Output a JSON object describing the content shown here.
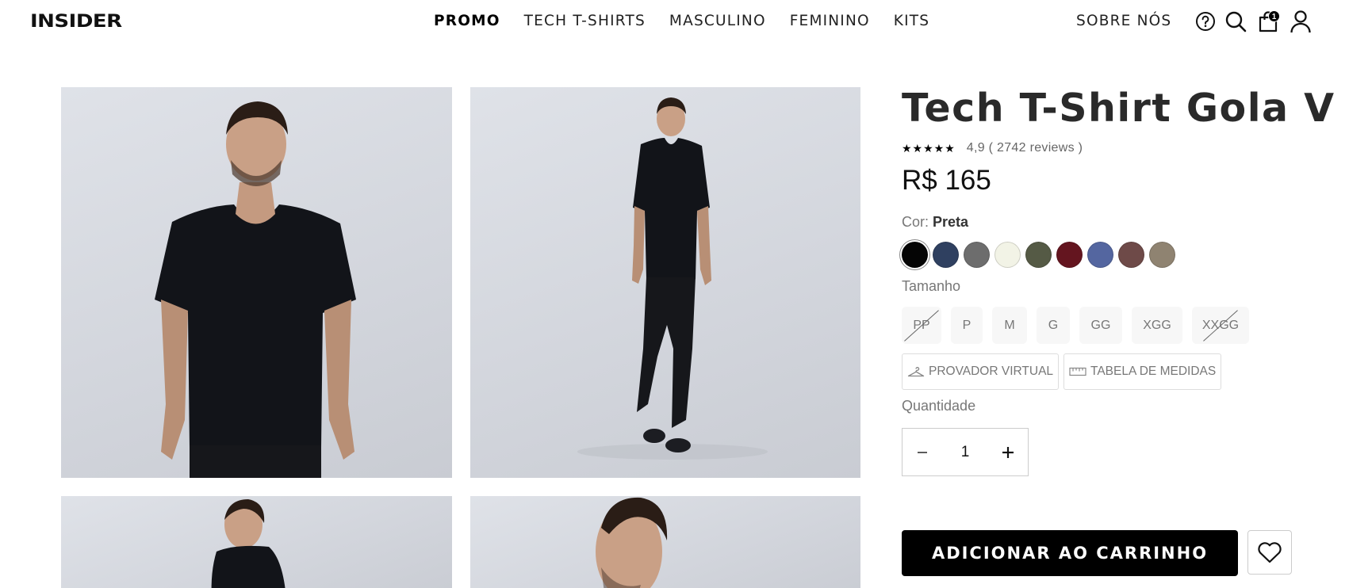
{
  "header": {
    "logo": "INSIDER",
    "nav": [
      "PROMO",
      "TECH T-SHIRTS",
      "MASCULINO",
      "FEMININO",
      "KITS"
    ],
    "about": "SOBRE NÓS",
    "cart_count": "1",
    "icons": [
      "help-icon",
      "search-icon",
      "cart-icon",
      "user-icon"
    ]
  },
  "product": {
    "title": "Tech T-Shirt Gola V",
    "stars": "★★★★★",
    "rating_text": "4,9 ( 2742 reviews )",
    "price": "R$ 165",
    "color_label": "Cor:",
    "color_selected": "Preta",
    "colors": [
      "#050505",
      "#2f4060",
      "#6d6d6d",
      "#f2f3e6",
      "#555a45",
      "#64151f",
      "#5466a0",
      "#6e4a48",
      "#8f8371"
    ],
    "size_label": "Tamanho",
    "sizes": [
      {
        "label": "PP",
        "available": false
      },
      {
        "label": "P",
        "available": true
      },
      {
        "label": "M",
        "available": true
      },
      {
        "label": "G",
        "available": true
      },
      {
        "label": "GG",
        "available": true
      },
      {
        "label": "XGG",
        "available": true
      },
      {
        "label": "XXGG",
        "available": false
      }
    ],
    "virtual_fitting": "PROVADOR VIRTUAL",
    "size_chart": "TABELA DE MEDIDAS",
    "quantity_label": "Quantidade",
    "quantity": "1",
    "add_to_cart": "ADICIONAR AO CARRINHO"
  },
  "gallery": {
    "images": [
      "front-view",
      "full-body",
      "side-view",
      "profile-closeup"
    ]
  }
}
